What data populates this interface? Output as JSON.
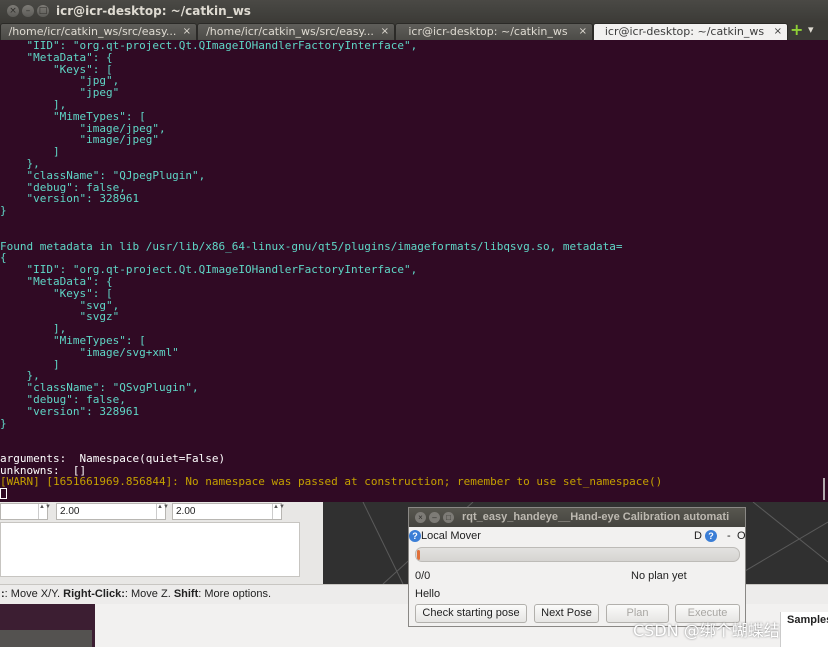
{
  "terminal": {
    "window_title": "icr@icr-desktop: ~/catkin_ws",
    "tabs": [
      {
        "label": "/home/icr/catkin_ws/src/easy..."
      },
      {
        "label": "/home/icr/catkin_ws/src/easy..."
      },
      {
        "label": "icr@icr-desktop: ~/catkin_ws"
      },
      {
        "label": "icr@icr-desktop: ~/catkin_ws"
      }
    ],
    "tab_close": "×",
    "new_tab": "+",
    "more_tabs": "▾",
    "lines": [
      {
        "text": "    \"IID\": \"org.qt-project.Qt.QImageIOHandlerFactoryInterface\",",
        "style": "c"
      },
      {
        "text": "    \"MetaData\": {",
        "style": "c"
      },
      {
        "text": "        \"Keys\": [",
        "style": "c"
      },
      {
        "text": "            \"jpg\",",
        "style": "c"
      },
      {
        "text": "            \"jpeg\"",
        "style": "c"
      },
      {
        "text": "        ],",
        "style": "c"
      },
      {
        "text": "        \"MimeTypes\": [",
        "style": "c"
      },
      {
        "text": "            \"image/jpeg\",",
        "style": "c"
      },
      {
        "text": "            \"image/jpeg\"",
        "style": "c"
      },
      {
        "text": "        ]",
        "style": "c"
      },
      {
        "text": "    },",
        "style": "c"
      },
      {
        "text": "    \"className\": \"QJpegPlugin\",",
        "style": "c"
      },
      {
        "text": "    \"debug\": false,",
        "style": "c"
      },
      {
        "text": "    \"version\": 328961",
        "style": "c"
      },
      {
        "text": "}",
        "style": "c"
      },
      {
        "text": "",
        "style": "c"
      },
      {
        "text": "",
        "style": "c"
      },
      {
        "text": "Found metadata in lib /usr/lib/x86_64-linux-gnu/qt5/plugins/imageformats/libqsvg.so, metadata=",
        "style": "c"
      },
      {
        "text": "{",
        "style": "c"
      },
      {
        "text": "    \"IID\": \"org.qt-project.Qt.QImageIOHandlerFactoryInterface\",",
        "style": "c"
      },
      {
        "text": "    \"MetaData\": {",
        "style": "c"
      },
      {
        "text": "        \"Keys\": [",
        "style": "c"
      },
      {
        "text": "            \"svg\",",
        "style": "c"
      },
      {
        "text": "            \"svgz\"",
        "style": "c"
      },
      {
        "text": "        ],",
        "style": "c"
      },
      {
        "text": "        \"MimeTypes\": [",
        "style": "c"
      },
      {
        "text": "            \"image/svg+xml\"",
        "style": "c"
      },
      {
        "text": "        ]",
        "style": "c"
      },
      {
        "text": "    },",
        "style": "c"
      },
      {
        "text": "    \"className\": \"QSvgPlugin\",",
        "style": "c"
      },
      {
        "text": "    \"debug\": false,",
        "style": "c"
      },
      {
        "text": "    \"version\": 328961",
        "style": "c"
      },
      {
        "text": "}",
        "style": "c"
      },
      {
        "text": "",
        "style": "c"
      },
      {
        "text": "",
        "style": "c"
      },
      {
        "text": "arguments:  Namespace(quiet=False)",
        "style": "w"
      },
      {
        "text": "unknowns:  []",
        "style": "w"
      },
      {
        "text": "[WARN] [1651661969.856844]: No namespace was passed at construction; remember to use set_namespace()",
        "style": "warn"
      }
    ]
  },
  "background": {
    "spinboxes": [
      "2.00",
      "2.00"
    ],
    "spin_arrows": "▲▼",
    "statusbar": {
      "k1": ":",
      "t1": ": Move X/Y. ",
      "k2": "Right-Click:",
      "t2": ": Move Z. ",
      "k3": "Shift",
      "t3": ": More options."
    },
    "samples_label": "Samples"
  },
  "dialog": {
    "title": "rqt_easy_handeye__Hand-eye Calibration automati",
    "plugin_name": "Local Mover",
    "d_icon": "D",
    "minimize": "-",
    "close": "O",
    "help": "?",
    "progress": 0.01,
    "progress_color": "#e0703a",
    "count": "0/0",
    "plan_status": "No plan yet",
    "message": "Hello",
    "buttons": {
      "check": "Check starting pose",
      "next": "Next Pose",
      "plan": "Plan",
      "execute": "Execute"
    }
  },
  "watermark": "CSDN @绑个蝴蝶结"
}
